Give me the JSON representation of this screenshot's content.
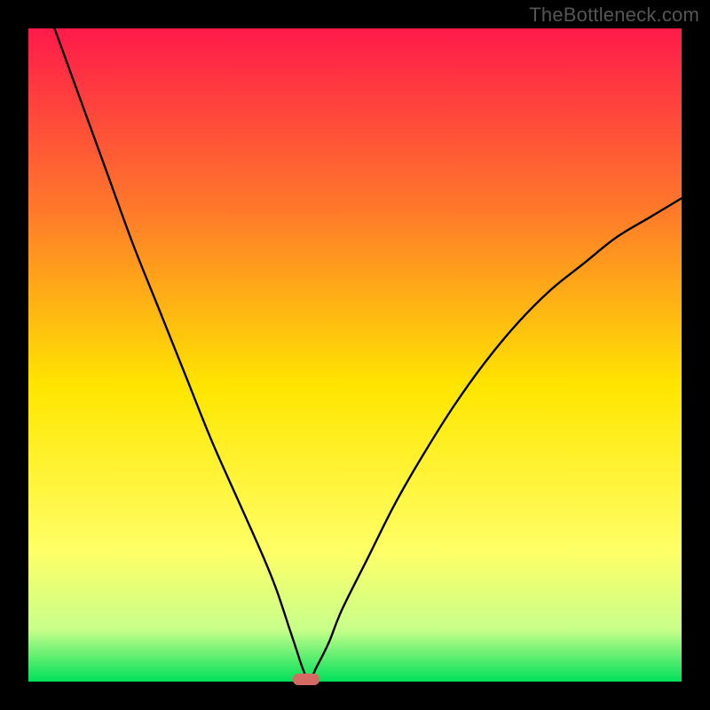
{
  "attribution": "TheBottleneck.com",
  "colors": {
    "bg": "#000000",
    "grad_top": "#ff1a4a",
    "grad_upper_mid": "#ff7a2a",
    "grad_mid": "#ffe600",
    "grad_lower_mid": "#f7ff80",
    "grad_near_bottom": "#c8ff8a",
    "grad_bottom": "#00e05a",
    "curve": "#000000",
    "marker": "#d56a63"
  },
  "chart_data": {
    "type": "line",
    "title": "",
    "xlabel": "",
    "ylabel": "",
    "xlim": [
      0,
      100
    ],
    "ylim": [
      0,
      100
    ],
    "series": [
      {
        "name": "bottleneck-curve",
        "x": [
          4,
          8,
          12,
          16,
          20,
          24,
          28,
          32,
          36,
          38,
          40,
          41,
          42,
          43,
          44,
          46,
          48,
          52,
          56,
          60,
          65,
          70,
          75,
          80,
          85,
          90,
          95,
          100
        ],
        "values": [
          100,
          89,
          78,
          67,
          57,
          47,
          37,
          28,
          19,
          14,
          8,
          5,
          2,
          0,
          2,
          6,
          11,
          19,
          27,
          34,
          42,
          49,
          55,
          60,
          64,
          68,
          71,
          74
        ]
      }
    ],
    "marker": {
      "x": 42.5,
      "y": 0.3
    },
    "gradient_stops": [
      {
        "offset": 0.0,
        "color": "#ff1a4a"
      },
      {
        "offset": 0.28,
        "color": "#ff7a2a"
      },
      {
        "offset": 0.55,
        "color": "#ffe600"
      },
      {
        "offset": 0.8,
        "color": "#ffff66"
      },
      {
        "offset": 0.92,
        "color": "#c8ff8a"
      },
      {
        "offset": 1.0,
        "color": "#00e05a"
      }
    ]
  }
}
